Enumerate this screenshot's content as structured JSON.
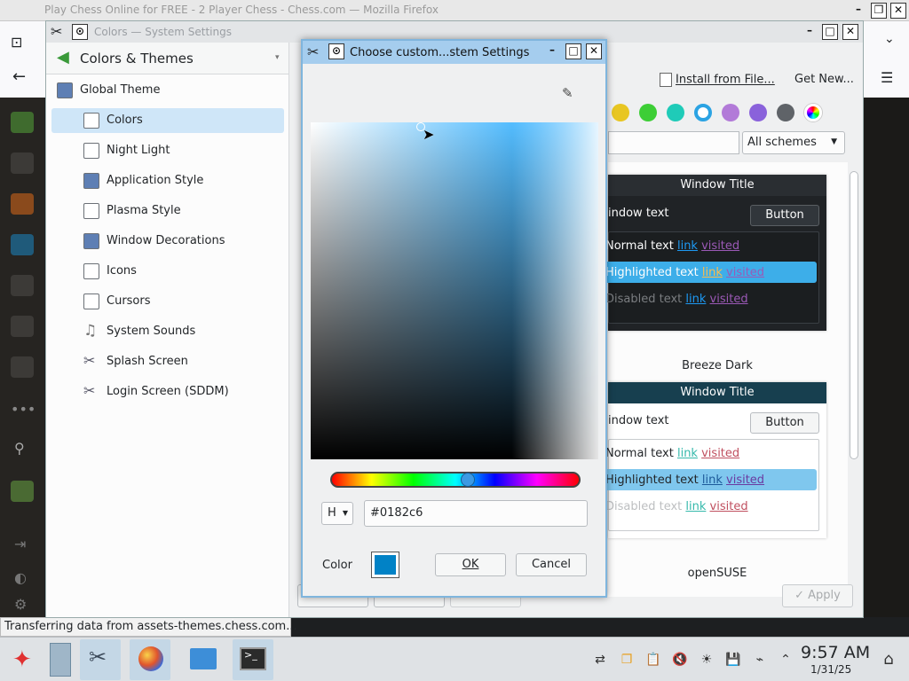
{
  "firefox": {
    "window_title": "Play Chess Online for FREE - 2 Player Chess - Chess.com — Mozilla Firefox",
    "status_text": "Transferring data from assets-themes.chess.com..."
  },
  "settings": {
    "window_title": "Colors — System Settings",
    "sidebar": {
      "header": "Colors & Themes",
      "items": [
        {
          "label": "Global Theme"
        },
        {
          "label": "Colors",
          "selected": true
        },
        {
          "label": "Night Light"
        },
        {
          "label": "Application Style"
        },
        {
          "label": "Plasma Style"
        },
        {
          "label": "Window Decorations"
        },
        {
          "label": "Icons"
        },
        {
          "label": "Cursors"
        },
        {
          "label": "System Sounds"
        },
        {
          "label": "Splash Screen"
        },
        {
          "label": "Login Screen (SDDM)"
        }
      ]
    },
    "toolbar": {
      "install_label": "Install from File...",
      "get_new_label": "Get New..."
    },
    "accent_swatches": [
      "#e8c622",
      "#3dce36",
      "#1fcbb8",
      "#2ba3e3",
      "#b27ad8",
      "#8a62db",
      "#5f6368"
    ],
    "filter_value": "All schemes",
    "schemes": [
      {
        "name": "Breeze Dark",
        "window_title": "Window Title",
        "window_text": "indow text",
        "button": "Button",
        "normal_text": "Normal text",
        "highlighted_text": "Highlighted text",
        "disabled_text": "Disabled text",
        "link": "link",
        "visited": "visited",
        "colors": {
          "title": "#2a2e32",
          "bg": "#202326",
          "text": "#fcfcfc",
          "highlight": "#3daee9"
        }
      },
      {
        "name": "openSUSE",
        "window_title": "Window Title",
        "window_text": "indow text",
        "button": "Button",
        "normal_text": "Normal text",
        "highlighted_text": "Highlighted text",
        "disabled_text": "Disabled text",
        "link": "link",
        "visited": "visited",
        "colors": {
          "title": "#173f4f",
          "bg": "#ffffff",
          "text": "#232629",
          "highlight": "#7fc7ee"
        }
      }
    ],
    "apply_label": "Apply"
  },
  "dialog": {
    "title": "Choose custom...stem Settings",
    "mode_value": "H",
    "hex_value": "#0182c6",
    "color_label": "Color",
    "selected_color": "#0182c6",
    "ok_label": "OK",
    "cancel_label": "Cancel"
  },
  "taskbar": {
    "time": "9:57 AM",
    "date": "1/31/25"
  }
}
